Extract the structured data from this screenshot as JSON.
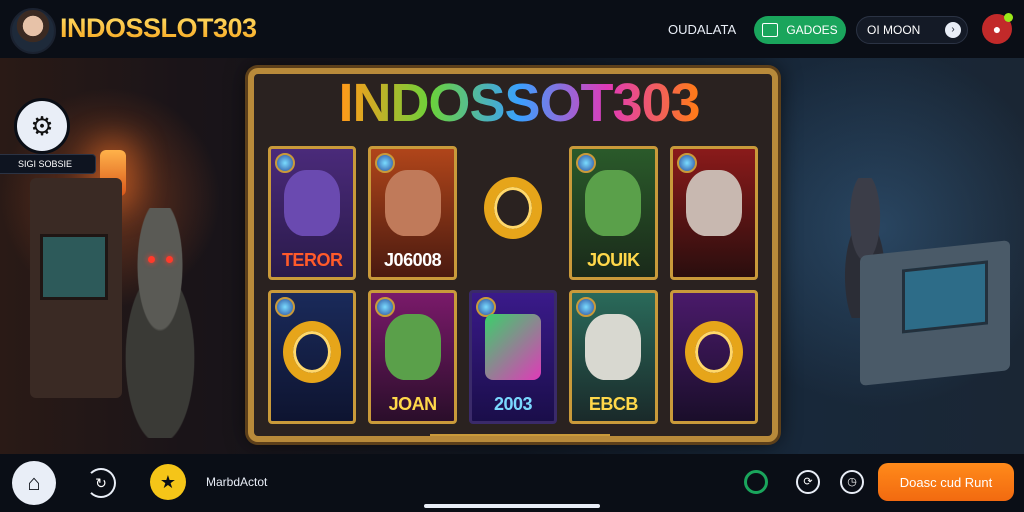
{
  "header": {
    "brand": "INDOSSLOT303",
    "link_label": "OUDALATA",
    "green_pill_label": "GADOES",
    "dark_pill_label": "OI MOON"
  },
  "sidebar": {
    "label": "SIGI SOBSIE"
  },
  "game": {
    "title": "INDOSSOT303",
    "tiles": [
      {
        "caption": "TEROR",
        "color": "#ff5a2a"
      },
      {
        "caption": "J06008",
        "color": "#ffffff"
      },
      {
        "caption": "",
        "color": "#e6a51a"
      },
      {
        "caption": "JOUIK",
        "color": "#ffd84a"
      },
      {
        "caption": "",
        "color": "#e6a51a"
      },
      {
        "caption": "",
        "color": "#e6a51a"
      },
      {
        "caption": "JOAN",
        "color": "#ffd84a"
      },
      {
        "caption": "2003",
        "color": "#7ad8ff"
      },
      {
        "caption": "EBCB",
        "color": "#ffd84a"
      },
      {
        "caption": "",
        "color": "#e6a51a"
      }
    ]
  },
  "footer": {
    "label": "MarbdActot",
    "cta_label": "Doasc cud Runt"
  },
  "colors": {
    "accent_orange": "#f57c16",
    "accent_green": "#1aa55c",
    "accent_yellow": "#f5c518",
    "gold_frame": "#b88a3a"
  }
}
